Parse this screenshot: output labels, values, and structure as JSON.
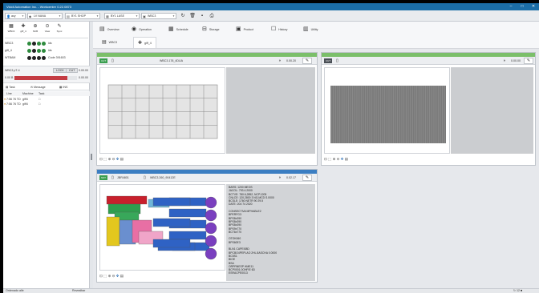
{
  "window": {
    "title": "Vicidi Automation Inc. - Workcenter 0.22.0873",
    "controls": {
      "minimize": "–",
      "maximize": "□",
      "close": "✕"
    }
  },
  "toolbar": {
    "user": "acy",
    "machine": "LV NANA",
    "job": "BY1 SHOP",
    "material": "BY1 LASE",
    "sheet": "WBC3",
    "icons": [
      "refresh-icon",
      "delete-icon",
      "save-icon",
      "print-icon"
    ]
  },
  "left": {
    "tools": [
      {
        "label": "WBC3",
        "icon": "▦"
      },
      {
        "label": "giff_4",
        "icon": "✚"
      },
      {
        "label": "NCB",
        "icon": "⊕"
      },
      {
        "label": "View",
        "icon": "⊙"
      },
      {
        "label": "Sync",
        "icon": "✎"
      }
    ],
    "status_rows": [
      {
        "name": "WBC3",
        "label": "ids"
      },
      {
        "name": "giff_4",
        "label": "ids"
      },
      {
        "name": "WTBAM",
        "label": "Code 391603"
      }
    ],
    "machine": {
      "name": "WBC3 pT-4",
      "button_a": "LOCK",
      "button_b": "CUT",
      "value": "0.00.00",
      "progress_label": "0.00 B",
      "progress": 0.85
    },
    "tabs": [
      "Task",
      "Message",
      "INS"
    ],
    "columns": [
      "Line",
      "Machine",
      "Task"
    ],
    "rows": [
      {
        "time": "7:56 76 TD",
        "machine": "giff4",
        "task": "□"
      },
      {
        "time": "7:56 76 TD",
        "machine": "giff4",
        "task": "□"
      }
    ]
  },
  "nav": {
    "items": [
      {
        "icon": "▤",
        "label": "Overview"
      },
      {
        "icon": "◉",
        "label": "Operation"
      },
      {
        "icon": "▦",
        "label": "Schedule"
      },
      {
        "icon": "⊟",
        "label": "Storage"
      },
      {
        "icon": "▣",
        "label": "Product"
      },
      {
        "icon": "☐",
        "label": "History"
      },
      {
        "icon": "▥",
        "label": "Utility"
      }
    ],
    "subtabs": [
      {
        "icon": "▤",
        "label": "WBC3"
      },
      {
        "icon": "✚",
        "label": "giff_4"
      }
    ]
  },
  "panels": {
    "top_left": {
      "badge": "CUT",
      "name": "WBC3.178_4DUA",
      "time": "0.00.20",
      "stripe": "#7bbf6a",
      "badge_color": "#3a9e4f"
    },
    "top_right": {
      "badge": "CUT",
      "time": "0.00.00",
      "stripe": "#7bbf6a",
      "badge_color": "#4a4f56"
    },
    "bottom": {
      "badge": "NST",
      "sheet": "JBR4801",
      "name": "WBC3.260_90412E",
      "time": "0.02.17",
      "stripe": "#3b7ec2",
      "badge_color": "#3a9e4f"
    }
  },
  "info_lines": [
    "BARS: 1200 MEOS",
    "JACOL: 793 4.2000",
    "BCTVE: 780.6,2852, NCP.1205",
    "CNLCE: 120,2800 3 NG,MCD S.0000",
    "BCSLE: 1760 NETR 90 29.5",
    "DATE: 204 74 2020",
    "",
    "CONSECTIVA MPHABLE2",
    "BPERFG3",
    "BPS8x390",
    "BPS8x390",
    "BPS8x390",
    "BPS9x770",
    "BCT6x770",
    "",
    "OTOK060",
    "BPS60E3",
    "",
    "BLN1 CAPEI08D",
    "BPCBO4PEPLAO 2HL.8ASCHA 0.0000",
    "BC5S1",
    "BIOE",
    "BSA",
    "ORPRNESP HME11",
    "BCP0001.0OHFIE 6D",
    "ESRACPE0013"
  ],
  "parts": {
    "blue": 9,
    "purple": 5
  },
  "status": {
    "left": "Ordenado alle",
    "mid": "Revealbar",
    "right": "↻ 12 ■"
  }
}
